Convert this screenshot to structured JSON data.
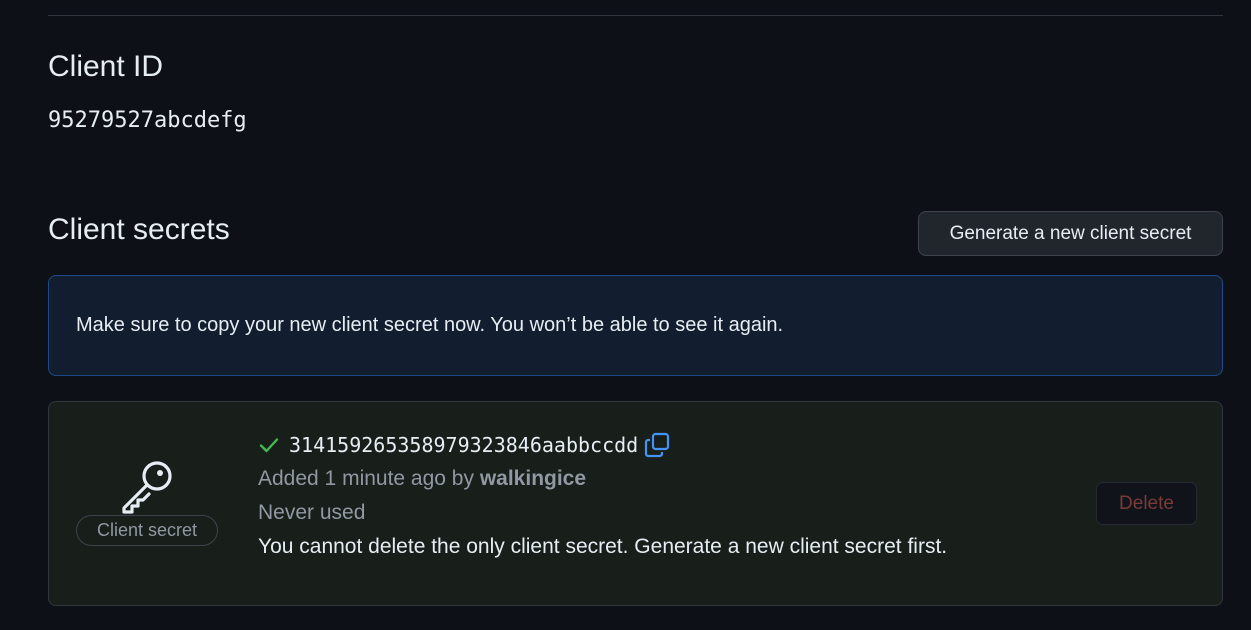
{
  "client_id": {
    "heading": "Client ID",
    "value": "95279527abcdefg"
  },
  "client_secrets": {
    "heading": "Client secrets",
    "generate_button_label": "Generate a new client secret",
    "flash_message": "Make sure to copy your new client secret now. You won’t be able to see it again.",
    "secret": {
      "badge_label": "Client secret",
      "value": "31415926535897932384 6aabbccdd",
      "added_prefix": "Added 1 minute ago by ",
      "added_by": "walkingice",
      "usage": "Never used",
      "delete_notice": "You cannot delete the only client secret. Generate a new client secret first.",
      "delete_button_label": "Delete",
      "delete_disabled": true
    }
  },
  "icons": {
    "key": "key-icon",
    "check": "check-icon",
    "copy": "copy-icon"
  },
  "colors": {
    "background": "#0d1117",
    "flash_background": "#121d2f",
    "flash_border": "#1f4a8a",
    "secret_box_background": "#181e1a",
    "check_green": "#3fb950",
    "copy_blue": "#4493f8",
    "delete_text": "#7a3a36"
  }
}
